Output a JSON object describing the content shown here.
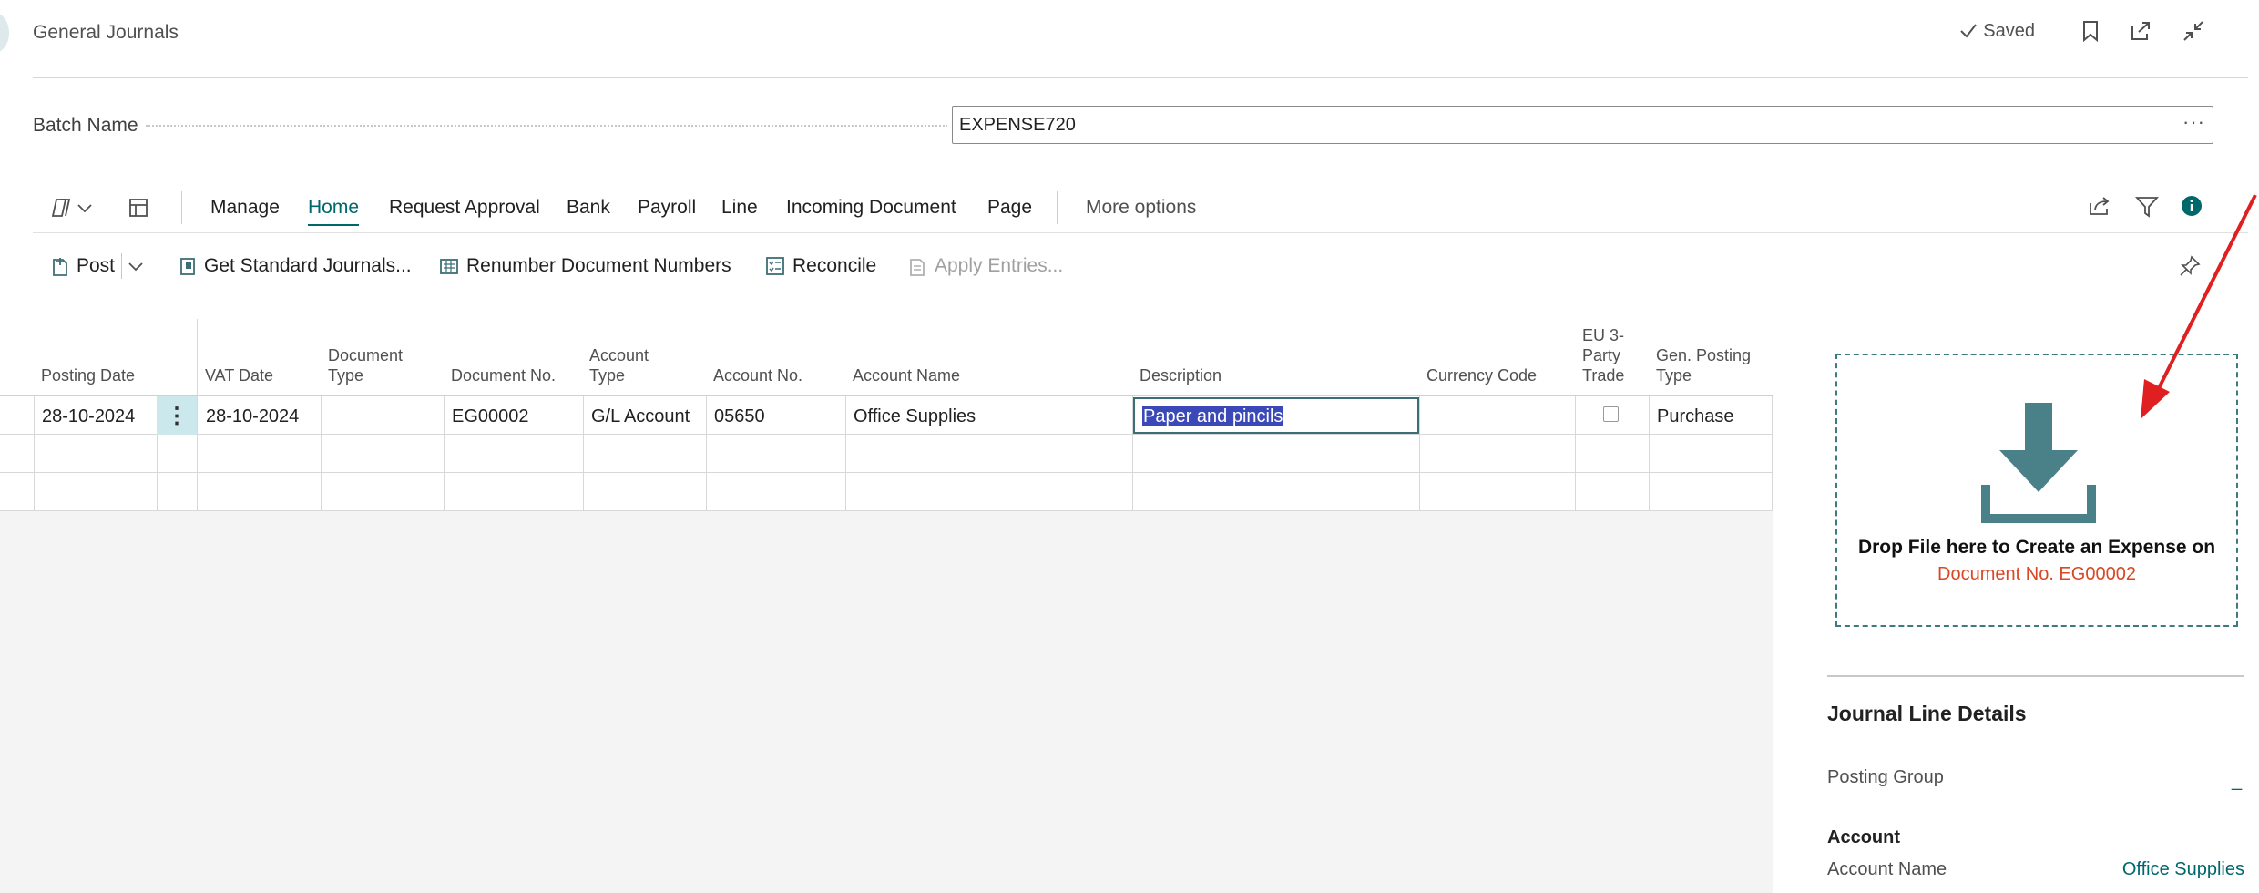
{
  "page": {
    "title": "General Journals",
    "saved_label": "Saved",
    "icons": [
      "bookmark-icon",
      "open-new-window-icon",
      "collapse-icon"
    ]
  },
  "batch": {
    "label": "Batch Name",
    "value": "EXPENSE720",
    "more": "···"
  },
  "actionbar": {
    "items": [
      "Manage",
      "Home",
      "Request Approval",
      "Bank",
      "Payroll",
      "Line",
      "Incoming Document",
      "Page"
    ],
    "active": "Home",
    "more_options": "More options"
  },
  "toolbar": {
    "post": "Post",
    "get_standard": "Get Standard Journals...",
    "renumber": "Renumber Document Numbers",
    "reconcile": "Reconcile",
    "apply_entries": "Apply Entries..."
  },
  "grid": {
    "headers": {
      "posting_date": "Posting Date",
      "vat_date": "VAT Date",
      "document_type_1": "Document",
      "document_type_2": "Type",
      "document_no": "Document No.",
      "account_type_1": "Account",
      "account_type_2": "Type",
      "account_no": "Account No.",
      "account_name": "Account Name",
      "description": "Description",
      "currency_code": "Currency Code",
      "eu3_1": "EU 3-",
      "eu3_2": "Party",
      "eu3_3": "Trade",
      "gen_posting_1": "Gen. Posting",
      "gen_posting_2": "Type"
    },
    "row1": {
      "posting_date": "28-10-2024",
      "vat_date": "28-10-2024",
      "document_type": "",
      "document_no": "EG00002",
      "account_type": "G/L Account",
      "account_no": "05650",
      "account_name": "Office Supplies",
      "description": "Paper and pincils",
      "currency_code": "",
      "eu3_party_trade": false,
      "gen_posting_type": "Purchase"
    }
  },
  "drop_zone": {
    "text": "Drop File here to Create an Expense on",
    "document": "Document No. EG00002"
  },
  "details": {
    "title": "Journal Line Details",
    "posting_group_label": "Posting Group",
    "posting_group_value": "_",
    "account_heading": "Account",
    "account_name_label": "Account Name",
    "account_name_value": "Office Supplies"
  },
  "colors": {
    "accent": "#00676b",
    "drop_border": "#3d7b80",
    "doc_link": "#d94724",
    "arrow": "#e02020"
  }
}
